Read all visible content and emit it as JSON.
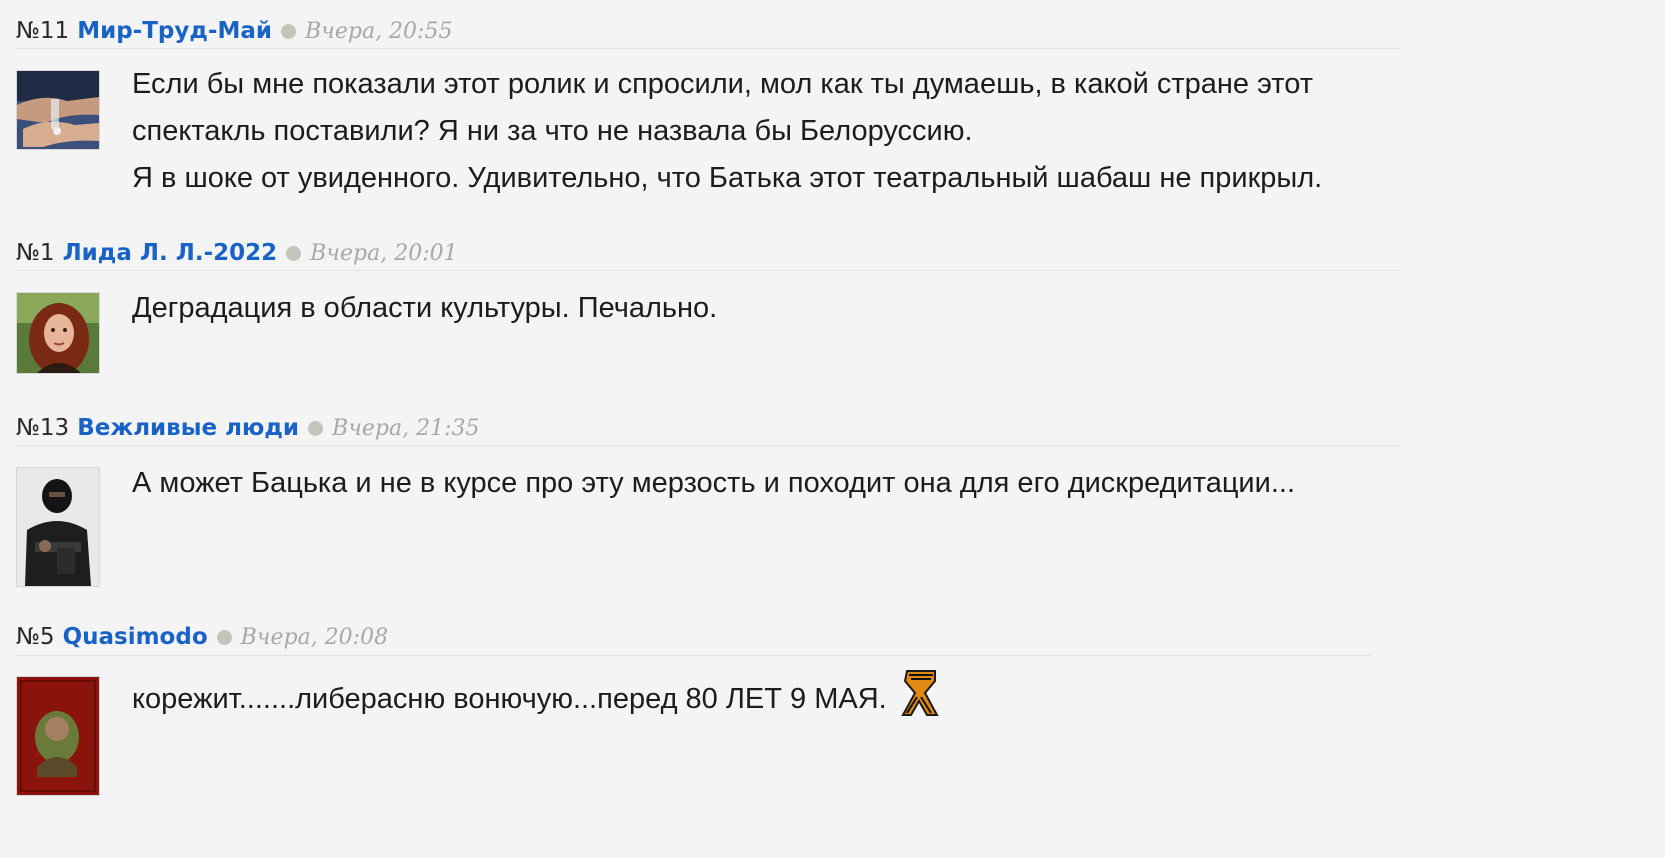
{
  "comments": [
    {
      "num": "№11",
      "author": "Мир-Труд-Май",
      "time": "Вчера, 20:55",
      "lines": [
        "Если бы мне показали этот ролик и спросили, мол как ты думаешь, в какой стране этот",
        "спектакль поставили? Я ни за что не назвала бы Белоруссию.",
        "Я в шоке от увиденного. Удивительно, что Батька этот театральный шабаш не прикрыл."
      ]
    },
    {
      "num": "№1",
      "author": "Лида Л. Л.-2022",
      "time": "Вчера, 20:01",
      "lines": [
        "Деградация в области культуры. Печально."
      ]
    },
    {
      "num": "№13",
      "author": "Вежливые люди",
      "time": "Вчера, 21:35",
      "lines": [
        "А может Бацька и не в курсе про эту мерзость и походит она для его дискредитации..."
      ]
    },
    {
      "num": "№5",
      "author": "Quasimodo",
      "time": "Вчера, 20:08",
      "lines": [
        "корежит.......либерасню вонючую...перед 80 ЛЕТ 9 МАЯ."
      ],
      "avatar_caption": "Quasimodo"
    }
  ],
  "colors": {
    "author": "#1a63c6",
    "time": "#a8a8a8",
    "background": "#f4f4f4",
    "dot": "#c4c4bb"
  },
  "icons": [
    "george-ribbon-icon"
  ]
}
